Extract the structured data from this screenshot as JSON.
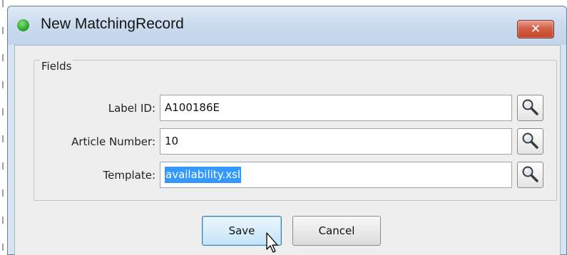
{
  "window": {
    "title": "New MatchingRecord",
    "close_label": "✕",
    "status_color": "#2ea82a"
  },
  "fields": {
    "group_label": "Fields",
    "label_id": {
      "label": "Label ID:",
      "value": "A100186E"
    },
    "article_number": {
      "label": "Article Number:",
      "value": "10"
    },
    "template": {
      "label": "Template:",
      "value": "availability.xsl",
      "selected": true
    }
  },
  "actions": {
    "save_label": "Save",
    "cancel_label": "Cancel"
  },
  "icons": {
    "lookup": "magnifier-icon",
    "cursor": "mouse-pointer-icon"
  }
}
